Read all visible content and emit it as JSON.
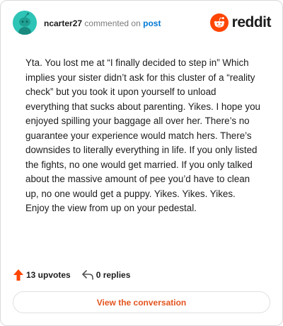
{
  "header": {
    "username": "ncarter27",
    "action_text": "commented on",
    "post_link": "post",
    "brand": "reddit",
    "avatar_icon": "snoo-avatar-icon",
    "brand_icon": "reddit-logo-icon"
  },
  "comment": {
    "body": "Yta. You lost me at “I finally decided to step in” Which implies your sister didn’t ask for this cluster of a “reality check” but you took it upon yourself to unload everything that sucks about parenting. Yikes. I hope you enjoyed spilling your baggage all over her. There’s no guarantee your experience would match hers. There’s downsides to literally everything in life. If you only listed the fights, no one would get married. If you only talked about the massive amount of pee you’d have to clean up, no one would get a puppy. Yikes. Yikes. Yikes. Enjoy the view from up on your pedestal."
  },
  "footer": {
    "upvotes": "13 upvotes",
    "replies": "0 replies",
    "upvote_icon": "upvote-arrow-icon",
    "reply_icon": "reply-arrow-icon",
    "view_button": "View the conversation"
  },
  "colors": {
    "accent": "#ff4500",
    "avatar_bg": "#2ec4b6",
    "link": "#0079d3",
    "button_text": "#e3541f"
  }
}
